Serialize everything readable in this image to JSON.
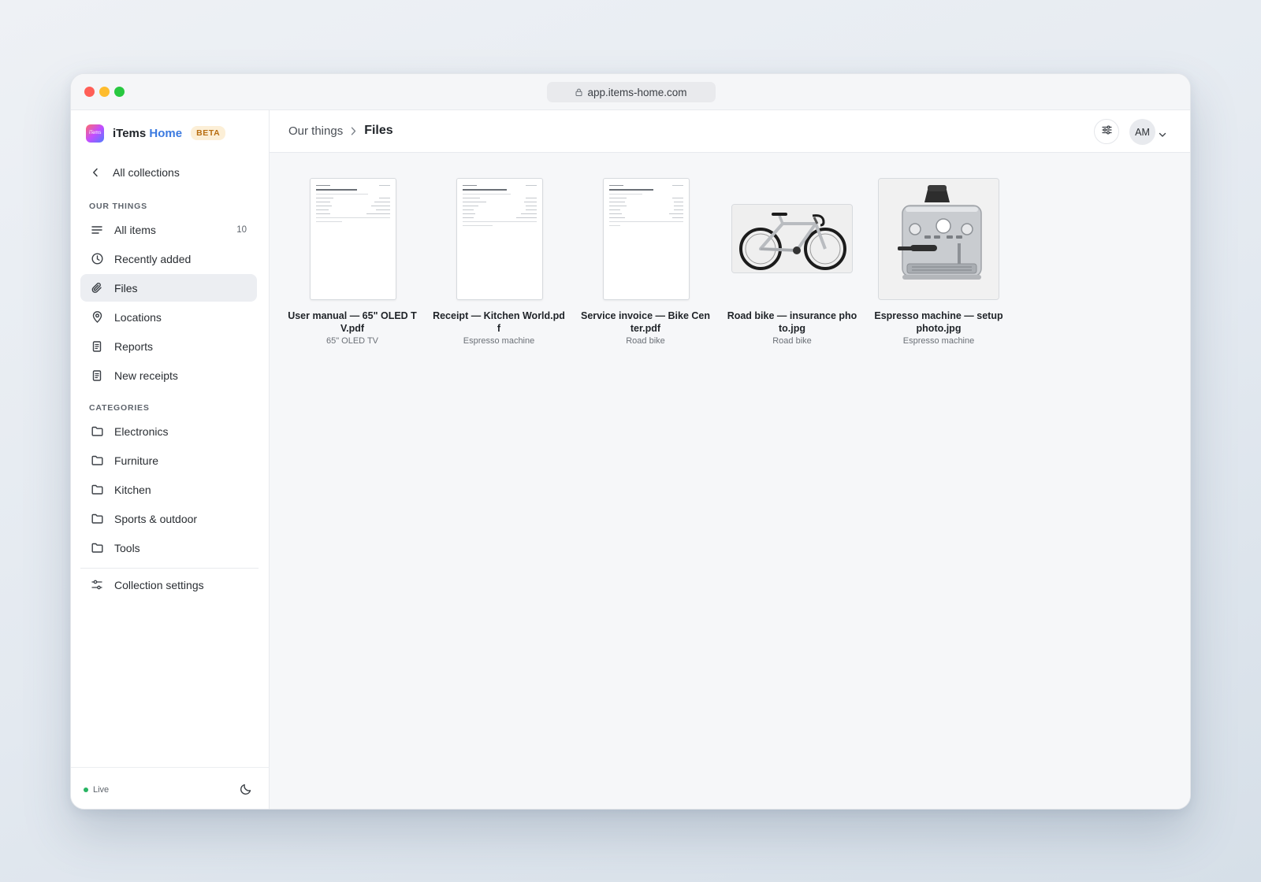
{
  "browser": {
    "url": "app.items-home.com"
  },
  "brand": {
    "logo_text": "iTems",
    "name_prefix": "iTems ",
    "name_accent": "Home",
    "badge": "BETA"
  },
  "sidebar": {
    "back_label": "All collections",
    "section_things": "OUR THINGS",
    "things": [
      {
        "label": "All items",
        "count": "10",
        "icon": "list-icon"
      },
      {
        "label": "Recently added",
        "icon": "clock-icon"
      },
      {
        "label": "Files",
        "icon": "paperclip-icon",
        "active": true
      },
      {
        "label": "Locations",
        "icon": "map-pin-icon"
      },
      {
        "label": "Reports",
        "icon": "document-icon"
      },
      {
        "label": "New receipts",
        "icon": "document-icon"
      }
    ],
    "section_categories": "CATEGORIES",
    "categories": [
      {
        "label": "Electronics",
        "icon": "folder-icon"
      },
      {
        "label": "Furniture",
        "icon": "folder-icon"
      },
      {
        "label": "Kitchen",
        "icon": "folder-icon"
      },
      {
        "label": "Sports & outdoor",
        "icon": "folder-icon"
      },
      {
        "label": "Tools",
        "icon": "folder-icon"
      }
    ],
    "settings_label": "Collection settings",
    "status": "Live"
  },
  "header": {
    "breadcrumb_parent": "Our things",
    "breadcrumb_current": "Files",
    "avatar_initials": "AM"
  },
  "files": [
    {
      "title": "User manual — 65\" OLED TV.pdf",
      "item": "65\" OLED TV",
      "kind": "pdf"
    },
    {
      "title": "Receipt — Kitchen World.pdf",
      "item": "Espresso machine",
      "kind": "pdf"
    },
    {
      "title": "Service invoice — Bike Center.pdf",
      "item": "Road bike",
      "kind": "pdf"
    },
    {
      "title": "Road bike — insurance photo.jpg",
      "item": "Road bike",
      "kind": "photo"
    },
    {
      "title": "Espresso machine — setup photo.jpg",
      "item": "Espresso machine",
      "kind": "photo"
    }
  ],
  "colors": {
    "accent": "#3b7ae0",
    "live": "#28b463",
    "beta_bg": "#fcefd7",
    "beta_text": "#b86e12"
  }
}
